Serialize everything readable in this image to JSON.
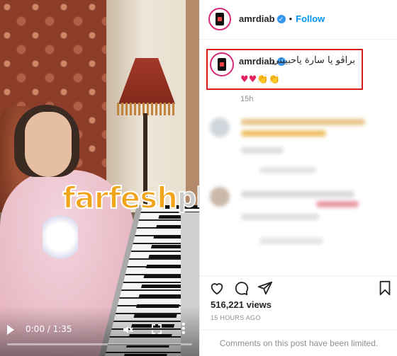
{
  "video": {
    "time": "0:00 / 1:35",
    "progress_fraction": 0,
    "watermark": {
      "part1": "farfesh",
      "part2": "plus.com"
    }
  },
  "post": {
    "header": {
      "username": "amrdiab",
      "separator": "•",
      "follow_label": "Follow"
    },
    "caption": {
      "username": "amrdiab",
      "text": "براڤو يا سارة ياحبيبتي",
      "emojis": "♥♥👏👏",
      "time": "15h"
    },
    "views": "516,221 views",
    "posted_ago": "15 HOURS AGO",
    "comments_notice": "Comments on this post have been limited."
  },
  "colors": {
    "highlight_box": "#d71b1b",
    "follow_blue": "#0095f6",
    "verified_blue": "#3897f0",
    "watermark_orange": "#f2a51a"
  },
  "icons": [
    "play-icon",
    "mute-icon",
    "fullscreen-icon",
    "more-icon",
    "verified-icon",
    "heart-icon",
    "comment-icon",
    "share-icon",
    "bookmark-icon"
  ]
}
